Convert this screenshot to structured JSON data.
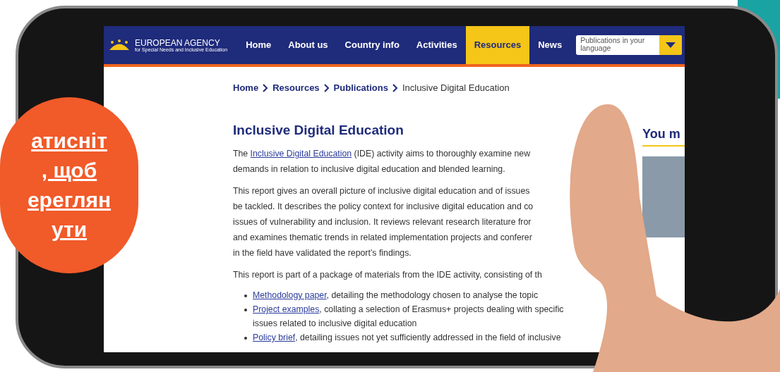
{
  "header": {
    "logo_title": "EUROPEAN AGENCY",
    "logo_subtitle": "for Special Needs and Inclusive Education",
    "nav": [
      {
        "label": "Home",
        "selected": false
      },
      {
        "label": "About us",
        "selected": false
      },
      {
        "label": "Country info",
        "selected": false
      },
      {
        "label": "Activities",
        "selected": false
      },
      {
        "label": "Resources",
        "selected": true
      },
      {
        "label": "News",
        "selected": false
      }
    ],
    "language_select": {
      "placeholder": "Publications in your language"
    }
  },
  "breadcrumb": [
    {
      "label": "Home",
      "link": true
    },
    {
      "label": "Resources",
      "link": true
    },
    {
      "label": "Publications",
      "link": true
    },
    {
      "label": "Inclusive Digital Education",
      "link": false
    }
  ],
  "article": {
    "title": "Inclusive Digital Education",
    "paragraphs": [
      [
        [
          {
            "text": "The ",
            "link": false
          },
          {
            "text": "Inclusive Digital Education",
            "link": true
          },
          {
            "text": " (IDE) activity aims to thoroughly examine new",
            "link": false
          }
        ],
        "demands in relation to inclusive digital education and blended learning."
      ],
      [
        "This report gives an overall picture of inclusive digital education and of issues",
        "be tackled. It describes the policy context for inclusive digital education and co",
        "issues of vulnerability and inclusion. It reviews relevant research literature fror",
        "and examines thematic trends in related implementation projects and conferer",
        "in the field have validated the report’s findings."
      ],
      [
        "This report is part of a package of materials from the IDE activity, consisting of th"
      ]
    ],
    "list": [
      {
        "link": "Methodology paper",
        "lines": [
          ", detailing the methodology chosen to analyse the topic"
        ]
      },
      {
        "link": "Project examples",
        "lines": [
          ", collating a selection of Erasmus+ projects dealing with specific",
          "issues related to inclusive digital education"
        ]
      },
      {
        "link": "Policy brief",
        "lines": [
          ", detailing issues not yet sufficiently addressed in the field of inclusive"
        ]
      }
    ]
  },
  "sidebar": {
    "title": "You m"
  },
  "overlay_button": {
    "lines": [
      "атисніт",
      ", щоб",
      "ереглян",
      "ути"
    ]
  }
}
